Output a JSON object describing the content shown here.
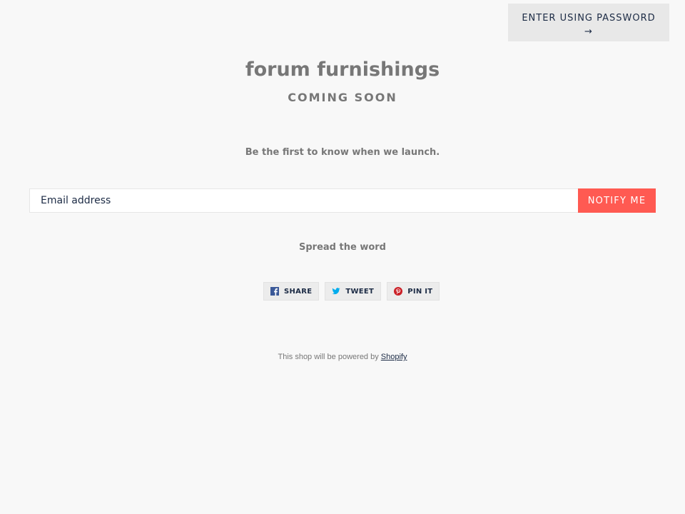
{
  "header": {
    "password_button_label": "ENTER USING PASSWORD",
    "password_button_arrow": "→"
  },
  "main": {
    "shop_name": "forum furnishings",
    "status": "COMING SOON",
    "tagline": "Be the first to know when we launch."
  },
  "signup": {
    "email_placeholder": "Email address",
    "submit_label": "NOTIFY ME",
    "accent_color": "#ff5a52"
  },
  "social": {
    "heading": "Spread the word",
    "buttons": [
      {
        "label": "SHARE",
        "icon": "facebook-icon",
        "color": "#3b5998"
      },
      {
        "label": "TWEET",
        "icon": "twitter-icon",
        "color": "#00aced"
      },
      {
        "label": "PIN IT",
        "icon": "pinterest-icon",
        "color": "#cb2027"
      }
    ]
  },
  "footer": {
    "powered_text": "This shop will be powered by",
    "powered_link": "Shopify"
  }
}
